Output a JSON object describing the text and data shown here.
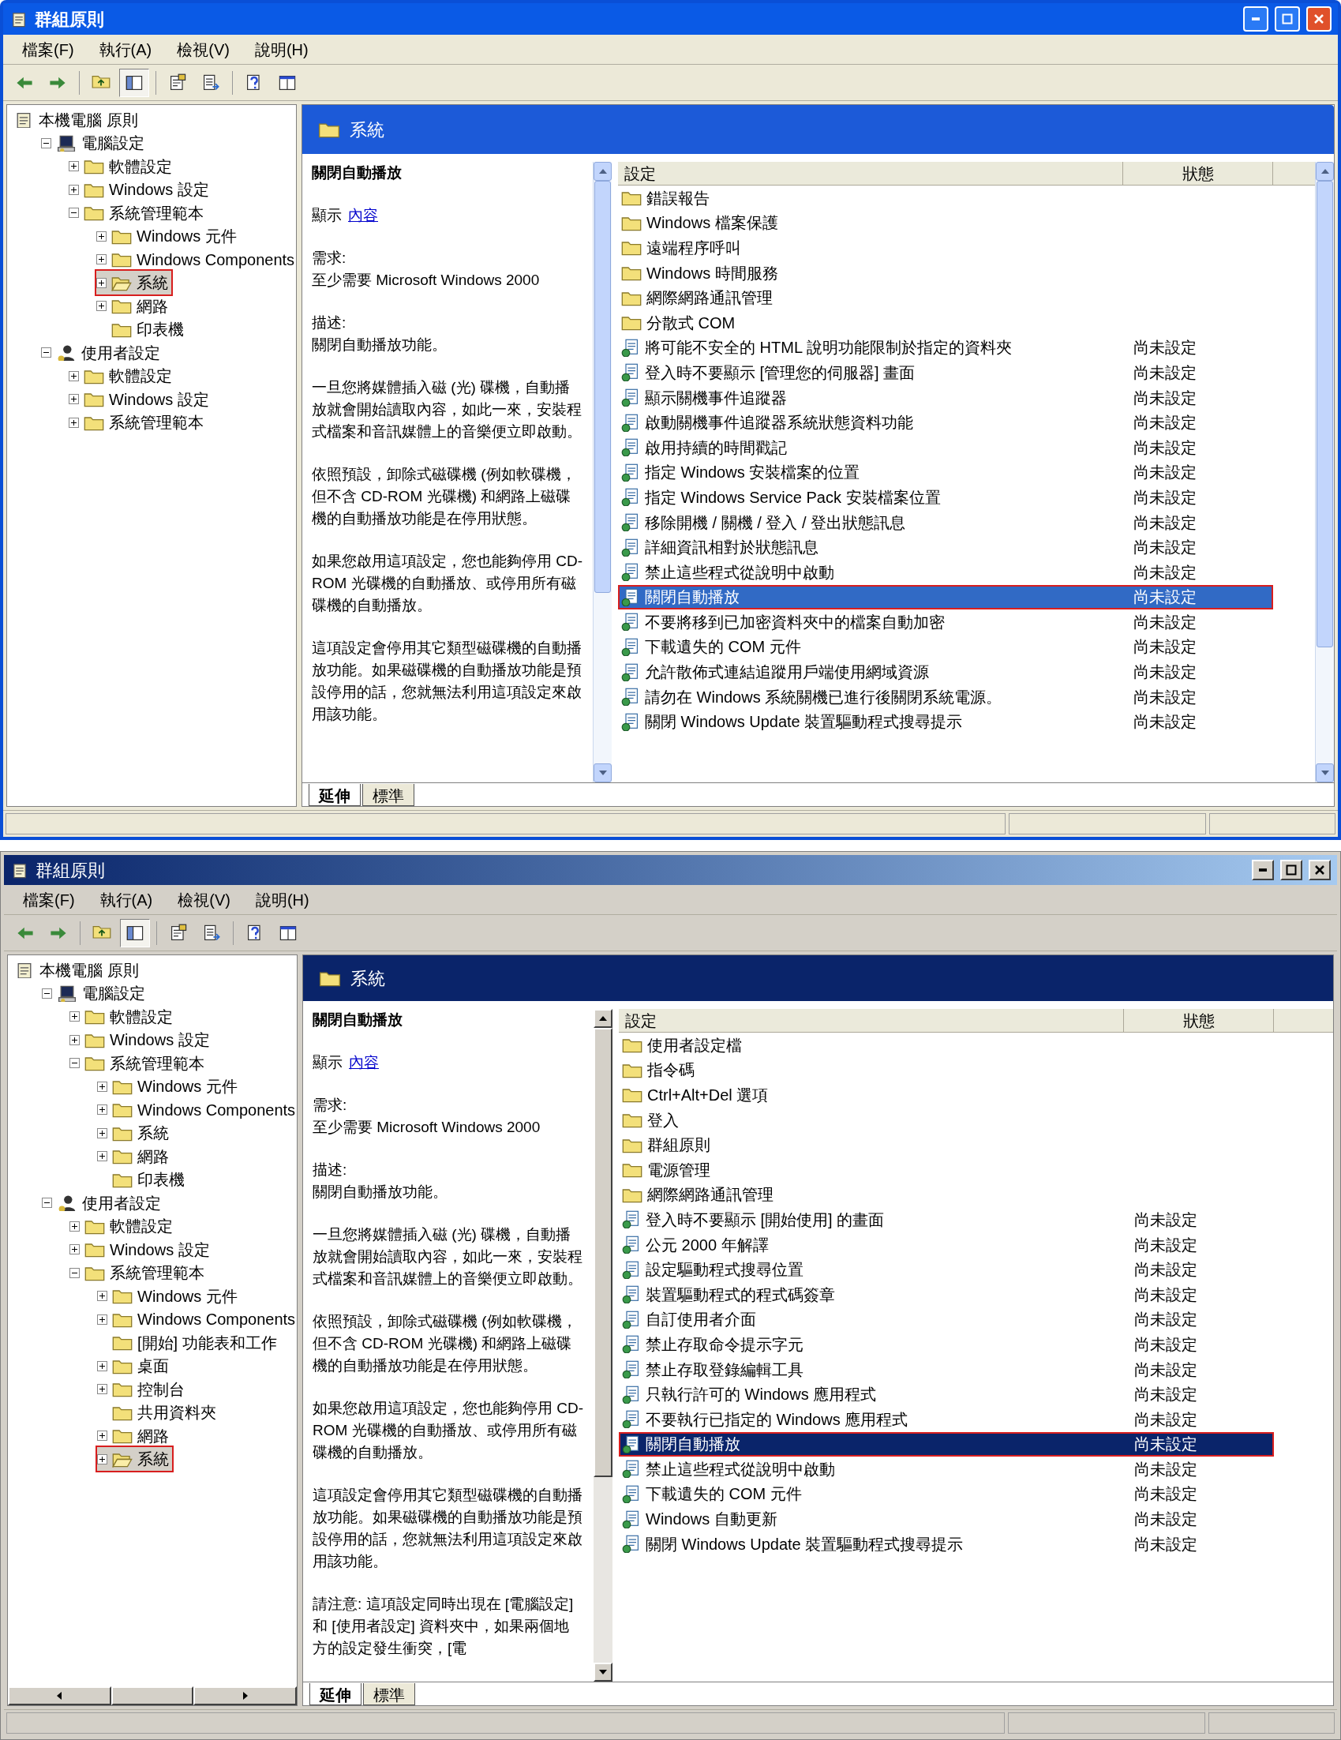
{
  "windows": [
    {
      "title": "群組原則",
      "menu": [
        "檔案(F)",
        "執行(A)",
        "檢視(V)",
        "說明(H)"
      ],
      "toolbar": [
        {
          "kind": "back",
          "pressed": false
        },
        {
          "kind": "forward",
          "pressed": false
        },
        {
          "kind": "up",
          "pressed": false
        },
        {
          "kind": "tree",
          "pressed": true
        },
        {
          "kind": "properties",
          "pressed": false
        },
        {
          "kind": "export",
          "pressed": false
        },
        {
          "kind": "help",
          "pressed": false
        },
        {
          "kind": "console",
          "pressed": false
        }
      ],
      "tree": [
        {
          "label": "本機電腦 原則",
          "kind": "policy",
          "selected": false,
          "children": [
            {
              "label": "電腦設定",
              "kind": "computer",
              "expanded": true,
              "selected": false,
              "children": [
                {
                  "label": "軟體設定",
                  "kind": "folder",
                  "expanded": false,
                  "selected": false
                },
                {
                  "label": "Windows 設定",
                  "kind": "folder",
                  "expanded": false,
                  "selected": false
                },
                {
                  "label": "系統管理範本",
                  "kind": "folder",
                  "expanded": true,
                  "selected": false,
                  "children": [
                    {
                      "label": "Windows 元件",
                      "kind": "folder",
                      "expanded": false,
                      "selected": false
                    },
                    {
                      "label": "Windows Components",
                      "kind": "folder",
                      "expanded": false,
                      "selected": false
                    },
                    {
                      "label": "系統",
                      "kind": "folder",
                      "expanded": false,
                      "selected": true
                    },
                    {
                      "label": "網路",
                      "kind": "folder",
                      "expanded": false,
                      "selected": false
                    },
                    {
                      "label": "印表機",
                      "kind": "folder",
                      "selected": false
                    }
                  ]
                }
              ]
            },
            {
              "label": "使用者設定",
              "kind": "user",
              "expanded": true,
              "selected": false,
              "children": [
                {
                  "label": "軟體設定",
                  "kind": "folder",
                  "expanded": false,
                  "selected": false
                },
                {
                  "label": "Windows 設定",
                  "kind": "folder",
                  "expanded": false,
                  "selected": false
                },
                {
                  "label": "系統管理範本",
                  "kind": "folder",
                  "expanded": false,
                  "selected": false
                }
              ]
            }
          ]
        }
      ],
      "header": "系統",
      "description": {
        "title": "關閉自動播放",
        "show_label": "顯示",
        "link": "內容",
        "requirement_label": "需求:",
        "requirement": "至少需要 Microsoft Windows 2000",
        "description_label": "描述:",
        "paragraphs": [
          "關閉自動播放功能。",
          "一旦您將媒體插入磁 (光) 碟機，自動播放就會開始讀取內容，如此一來，安裝程式檔案和音訊媒體上的音樂便立即啟動。",
          "依照預設，卸除式磁碟機 (例如軟碟機，但不含 CD-ROM 光碟機) 和網路上磁碟機的自動播放功能是在停用狀態。",
          "如果您啟用這項設定，您也能夠停用 CD-ROM 光碟機的自動播放、或停用所有磁碟機的自動播放。",
          "這項設定會停用其它類型磁碟機的自動播放功能。如果磁碟機的自動播放功能是預設停用的話，您就無法利用這項設定來啟用該功能。"
        ]
      },
      "columns": [
        "設定",
        "狀態"
      ],
      "rows": [
        {
          "kind": "folder",
          "name": "錯誤報告",
          "selected": false
        },
        {
          "kind": "folder",
          "name": "Windows 檔案保護",
          "selected": false
        },
        {
          "kind": "folder",
          "name": "遠端程序呼叫",
          "selected": false
        },
        {
          "kind": "folder",
          "name": "Windows 時間服務",
          "selected": false
        },
        {
          "kind": "folder",
          "name": "網際網路通訊管理",
          "selected": false
        },
        {
          "kind": "folder",
          "name": "分散式 COM",
          "selected": false
        },
        {
          "kind": "setting",
          "name": "將可能不安全的 HTML 說明功能限制於指定的資料夾",
          "state": "尚未設定",
          "selected": false
        },
        {
          "kind": "setting",
          "name": "登入時不要顯示 [管理您的伺服器] 畫面",
          "state": "尚未設定",
          "selected": false
        },
        {
          "kind": "setting",
          "name": "顯示關機事件追蹤器",
          "state": "尚未設定",
          "selected": false
        },
        {
          "kind": "setting",
          "name": "啟動關機事件追蹤器系統狀態資料功能",
          "state": "尚未設定",
          "selected": false
        },
        {
          "kind": "setting",
          "name": "啟用持續的時間戳記",
          "state": "尚未設定",
          "selected": false
        },
        {
          "kind": "setting",
          "name": "指定 Windows 安裝檔案的位置",
          "state": "尚未設定",
          "selected": false
        },
        {
          "kind": "setting",
          "name": "指定 Windows Service Pack 安裝檔案位置",
          "state": "尚未設定",
          "selected": false
        },
        {
          "kind": "setting",
          "name": "移除開機 / 關機 / 登入 / 登出狀態訊息",
          "state": "尚未設定",
          "selected": false
        },
        {
          "kind": "setting",
          "name": "詳細資訊相對於狀態訊息",
          "state": "尚未設定",
          "selected": false
        },
        {
          "kind": "setting",
          "name": "禁止這些程式從說明中啟動",
          "state": "尚未設定",
          "selected": false
        },
        {
          "kind": "setting",
          "name": "關閉自動播放",
          "state": "尚未設定",
          "selected": true
        },
        {
          "kind": "setting",
          "name": "不要將移到已加密資料夾中的檔案自動加密",
          "state": "尚未設定",
          "selected": false
        },
        {
          "kind": "setting",
          "name": "下載遺失的 COM 元件",
          "state": "尚未設定",
          "selected": false
        },
        {
          "kind": "setting",
          "name": "允許散佈式連結追蹤用戶端使用網域資源",
          "state": "尚未設定",
          "selected": false
        },
        {
          "kind": "setting",
          "name": "請勿在 Windows 系統關機已進行後關閉系統電源。",
          "state": "尚未設定",
          "selected": false
        },
        {
          "kind": "setting",
          "name": "關閉 Windows Update 裝置驅動程式搜尋提示",
          "state": "尚未設定",
          "selected": false
        }
      ],
      "tabs": [
        {
          "label": "延伸",
          "selected": true
        },
        {
          "label": "標準",
          "selected": false
        }
      ]
    },
    {
      "title": "群組原則",
      "menu": [
        "檔案(F)",
        "執行(A)",
        "檢視(V)",
        "說明(H)"
      ],
      "toolbar": [
        {
          "kind": "back",
          "pressed": false
        },
        {
          "kind": "forward",
          "pressed": false
        },
        {
          "kind": "up",
          "pressed": false
        },
        {
          "kind": "tree",
          "pressed": true
        },
        {
          "kind": "properties",
          "pressed": false
        },
        {
          "kind": "export",
          "pressed": false
        },
        {
          "kind": "help",
          "pressed": false
        },
        {
          "kind": "console",
          "pressed": false
        }
      ],
      "tree": [
        {
          "label": "本機電腦 原則",
          "kind": "policy",
          "selected": false,
          "children": [
            {
              "label": "電腦設定",
              "kind": "computer",
              "expanded": true,
              "selected": false,
              "children": [
                {
                  "label": "軟體設定",
                  "kind": "folder",
                  "expanded": false,
                  "selected": false
                },
                {
                  "label": "Windows 設定",
                  "kind": "folder",
                  "expanded": false,
                  "selected": false
                },
                {
                  "label": "系統管理範本",
                  "kind": "folder",
                  "expanded": true,
                  "selected": false,
                  "children": [
                    {
                      "label": "Windows 元件",
                      "kind": "folder",
                      "expanded": false,
                      "selected": false
                    },
                    {
                      "label": "Windows Components",
                      "kind": "folder",
                      "expanded": false,
                      "selected": false
                    },
                    {
                      "label": "系統",
                      "kind": "folder",
                      "expanded": false,
                      "selected": false
                    },
                    {
                      "label": "網路",
                      "kind": "folder",
                      "expanded": false,
                      "selected": false
                    },
                    {
                      "label": "印表機",
                      "kind": "folder",
                      "selected": false
                    }
                  ]
                }
              ]
            },
            {
              "label": "使用者設定",
              "kind": "user",
              "expanded": true,
              "selected": false,
              "children": [
                {
                  "label": "軟體設定",
                  "kind": "folder",
                  "expanded": false,
                  "selected": false
                },
                {
                  "label": "Windows 設定",
                  "kind": "folder",
                  "expanded": false,
                  "selected": false
                },
                {
                  "label": "系統管理範本",
                  "kind": "folder",
                  "expanded": true,
                  "selected": false,
                  "children": [
                    {
                      "label": "Windows 元件",
                      "kind": "folder",
                      "expanded": false,
                      "selected": false
                    },
                    {
                      "label": "Windows Components",
                      "kind": "folder",
                      "expanded": false,
                      "selected": false
                    },
                    {
                      "label": "[開始] 功能表和工作",
                      "kind": "folder",
                      "selected": false
                    },
                    {
                      "label": "桌面",
                      "kind": "folder",
                      "expanded": false,
                      "selected": false
                    },
                    {
                      "label": "控制台",
                      "kind": "folder",
                      "expanded": false,
                      "selected": false
                    },
                    {
                      "label": "共用資料夾",
                      "kind": "folder",
                      "selected": false
                    },
                    {
                      "label": "網路",
                      "kind": "folder",
                      "expanded": false,
                      "selected": false
                    },
                    {
                      "label": "系統",
                      "kind": "folder",
                      "expanded": false,
                      "selected": true
                    }
                  ]
                }
              ]
            }
          ]
        }
      ],
      "header": "系統",
      "description": {
        "title": "關閉自動播放",
        "show_label": "顯示",
        "link": "內容",
        "requirement_label": "需求:",
        "requirement": "至少需要 Microsoft Windows 2000",
        "description_label": "描述:",
        "paragraphs": [
          "關閉自動播放功能。",
          "一旦您將媒體插入磁 (光) 碟機，自動播放就會開始讀取內容，如此一來，安裝程式檔案和音訊媒體上的音樂便立即啟動。",
          "依照預設，卸除式磁碟機 (例如軟碟機，但不含 CD-ROM 光碟機) 和網路上磁碟機的自動播放功能是在停用狀態。",
          "如果您啟用這項設定，您也能夠停用 CD-ROM 光碟機的自動播放、或停用所有磁碟機的自動播放。",
          "這項設定會停用其它類型磁碟機的自動播放功能。如果磁碟機的自動播放功能是預設停用的話，您就無法利用這項設定來啟用該功能。",
          "請注意: 這項設定同時出現在 [電腦設定] 和 [使用者設定] 資料夾中，如果兩個地方的設定發生衝突，[電"
        ]
      },
      "columns": [
        "設定",
        "狀態"
      ],
      "rows": [
        {
          "kind": "folder",
          "name": "使用者設定檔",
          "selected": false
        },
        {
          "kind": "folder",
          "name": "指令碼",
          "selected": false
        },
        {
          "kind": "folder",
          "name": "Ctrl+Alt+Del 選項",
          "selected": false
        },
        {
          "kind": "folder",
          "name": "登入",
          "selected": false
        },
        {
          "kind": "folder",
          "name": "群組原則",
          "selected": false
        },
        {
          "kind": "folder",
          "name": "電源管理",
          "selected": false
        },
        {
          "kind": "folder",
          "name": "網際網路通訊管理",
          "selected": false
        },
        {
          "kind": "setting",
          "name": "登入時不要顯示 [開始使用] 的畫面",
          "state": "尚未設定",
          "selected": false
        },
        {
          "kind": "setting",
          "name": "公元 2000 年解譯",
          "state": "尚未設定",
          "selected": false
        },
        {
          "kind": "setting",
          "name": "設定驅動程式搜尋位置",
          "state": "尚未設定",
          "selected": false
        },
        {
          "kind": "setting",
          "name": "裝置驅動程式的程式碼簽章",
          "state": "尚未設定",
          "selected": false
        },
        {
          "kind": "setting",
          "name": "自訂使用者介面",
          "state": "尚未設定",
          "selected": false
        },
        {
          "kind": "setting",
          "name": "禁止存取命令提示字元",
          "state": "尚未設定",
          "selected": false
        },
        {
          "kind": "setting",
          "name": "禁止存取登錄編輯工具",
          "state": "尚未設定",
          "selected": false
        },
        {
          "kind": "setting",
          "name": "只執行許可的 Windows 應用程式",
          "state": "尚未設定",
          "selected": false
        },
        {
          "kind": "setting",
          "name": "不要執行已指定的 Windows 應用程式",
          "state": "尚未設定",
          "selected": false
        },
        {
          "kind": "setting",
          "name": "關閉自動播放",
          "state": "尚未設定",
          "selected": true
        },
        {
          "kind": "setting",
          "name": "禁止這些程式從說明中啟動",
          "state": "尚未設定",
          "selected": false
        },
        {
          "kind": "setting",
          "name": "下載遺失的 COM 元件",
          "state": "尚未設定",
          "selected": false
        },
        {
          "kind": "setting",
          "name": "Windows 自動更新",
          "state": "尚未設定",
          "selected": false
        },
        {
          "kind": "setting",
          "name": "關閉 Windows Update 裝置驅動程式搜尋提示",
          "state": "尚未設定",
          "selected": false
        }
      ],
      "tabs": [
        {
          "label": "延伸",
          "selected": true
        },
        {
          "label": "標準",
          "selected": false
        }
      ]
    }
  ]
}
